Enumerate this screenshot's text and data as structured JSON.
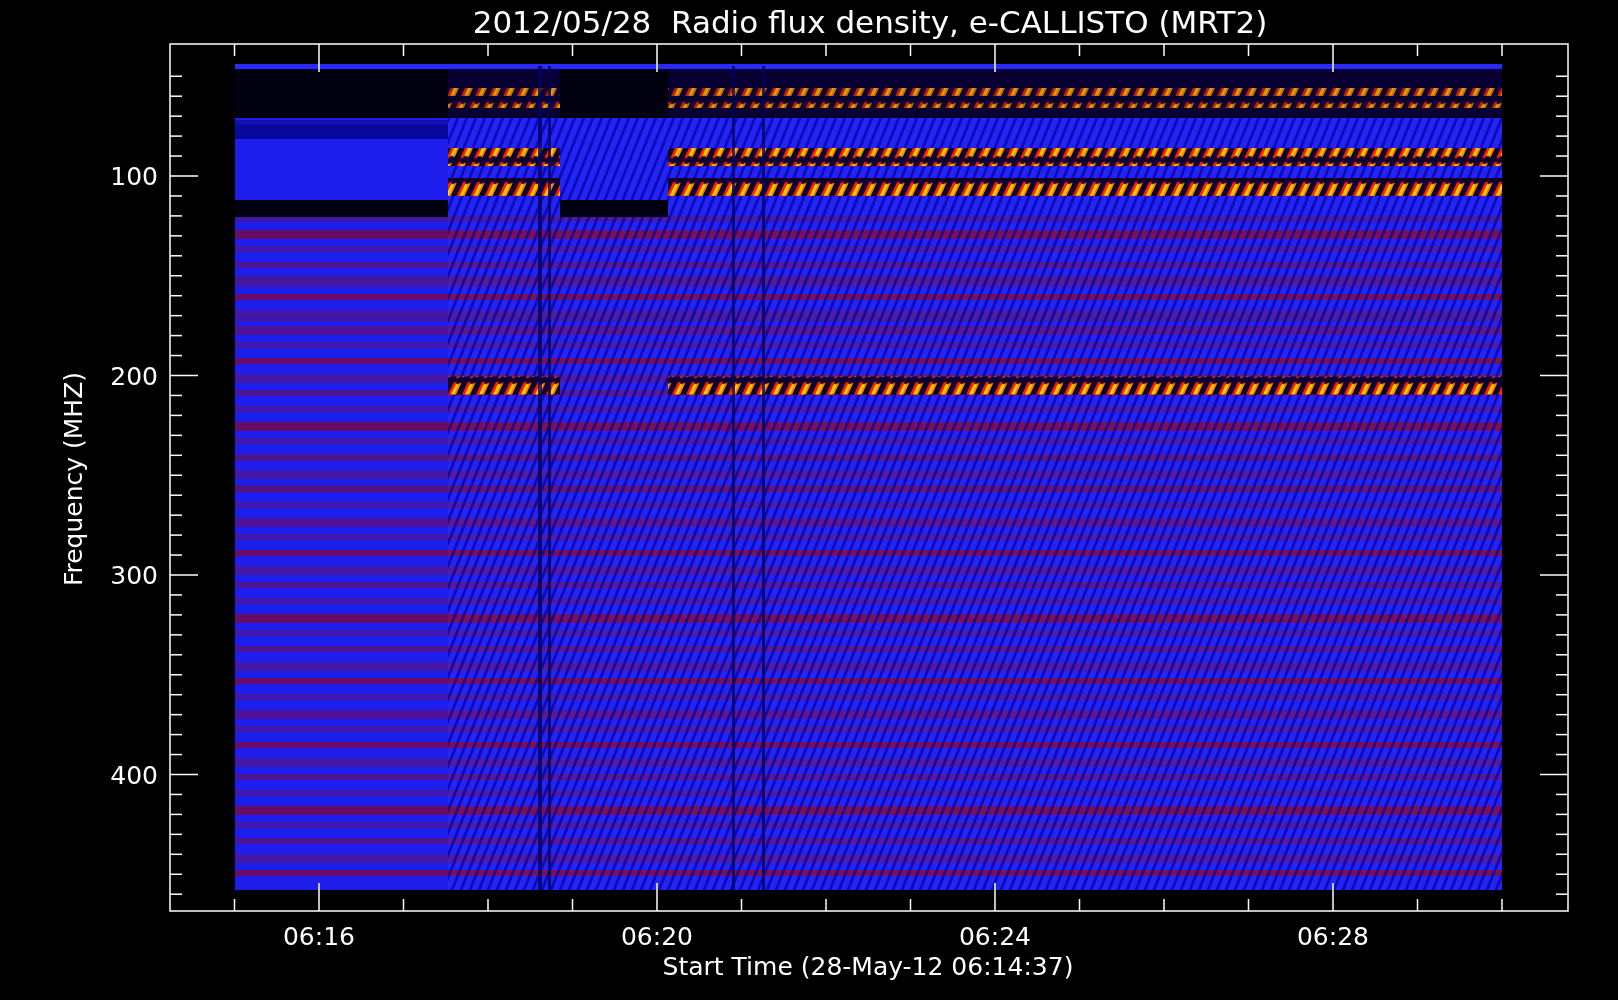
{
  "title": "2012/05/28  Radio flux density, e-CALLISTO (MRT2)",
  "y_axis": {
    "label": "Frequency (MHZ)",
    "ticks": [
      "100",
      "200",
      "300",
      "400"
    ]
  },
  "x_axis": {
    "label": "Start Time (28-May-12 06:14:37)",
    "ticks": [
      "06:16",
      "06:20",
      "06:24",
      "06:28"
    ]
  }
}
